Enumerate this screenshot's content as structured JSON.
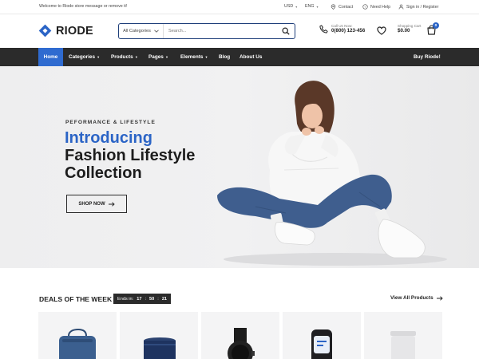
{
  "topbar": {
    "welcome": "Welcome to Riode store message or remove it!",
    "currency": "USD",
    "language": "ENG",
    "contact": "Contact",
    "help": "Need Help",
    "account": "Sign in / Register"
  },
  "header": {
    "brand": "RIODE",
    "search": {
      "category": "All Categories",
      "placeholder": "Search..."
    },
    "call": {
      "label": "Call Us Now:",
      "number": "0(800) 123-456"
    },
    "cart": {
      "label": "Shopping Cart",
      "amount": "$0.00",
      "count": "0"
    }
  },
  "nav": {
    "items": [
      {
        "label": "Home"
      },
      {
        "label": "Categories"
      },
      {
        "label": "Products"
      },
      {
        "label": "Pages"
      },
      {
        "label": "Elements"
      },
      {
        "label": "Blog"
      },
      {
        "label": "About Us"
      }
    ],
    "cta": "Buy Riode!"
  },
  "hero": {
    "eyebrow": "PEFORMANCE & LIFESTYLE",
    "line1": "Introducing",
    "line2": "Fashion Lifestyle",
    "line3": "Collection",
    "button": "SHOP NOW"
  },
  "deals": {
    "title": "DEALS OF THE WEEK",
    "timer_label": "Ends in:",
    "hours": "17",
    "minutes": "50",
    "seconds": "21",
    "view_all": "View All Products"
  },
  "colors": {
    "accent": "#2b64c6",
    "nav_bg": "#2b2b2b",
    "hero_bg": "#eeeeef"
  }
}
